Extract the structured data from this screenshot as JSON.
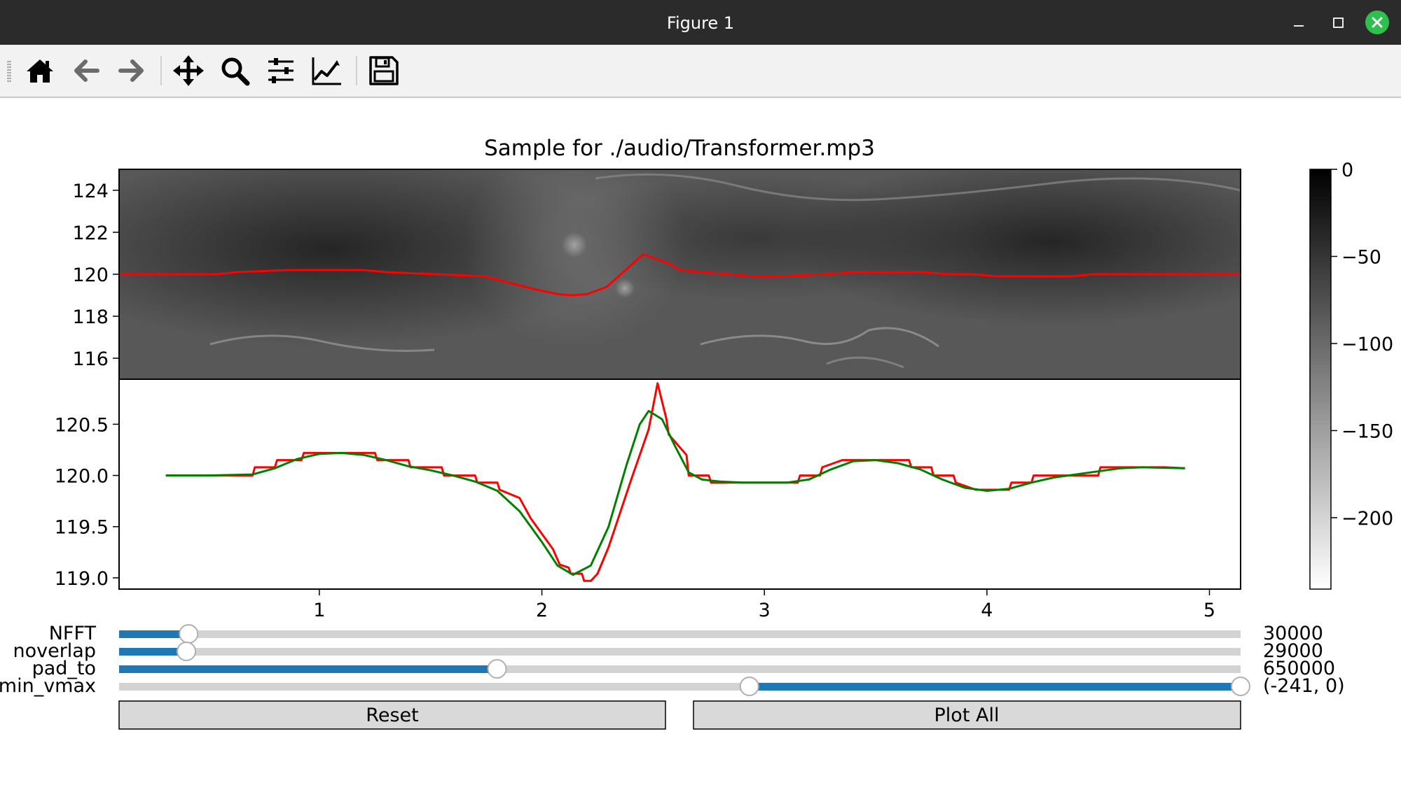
{
  "window": {
    "title": "Figure 1",
    "close_color": "#2ebf4f"
  },
  "toolbar": {
    "buttons": [
      {
        "name": "home-icon",
        "tooltip": "Reset original view"
      },
      {
        "name": "back-arrow-icon",
        "tooltip": "Back to previous view"
      },
      {
        "name": "forward-arrow-icon",
        "tooltip": "Forward to next view"
      },
      {
        "name": "pan-icon",
        "tooltip": "Pan axes"
      },
      {
        "name": "zoom-icon",
        "tooltip": "Zoom to rectangle"
      },
      {
        "name": "subplots-icon",
        "tooltip": "Configure subplots"
      },
      {
        "name": "edit-axes-icon",
        "tooltip": "Edit axis, curve and image parameters"
      },
      {
        "name": "save-icon",
        "tooltip": "Save the figure"
      }
    ]
  },
  "figure": {
    "title": "Sample for ./audio/Transformer.mp3",
    "colors": {
      "red_line": "#ff0000",
      "green_line": "#008000",
      "slider_fill": "#1f77b4",
      "slider_track": "#d3d3d3",
      "button_face": "#d9d9d9"
    },
    "colorbar": {
      "ticks": [
        {
          "v": 0,
          "label": "0"
        },
        {
          "v": -50,
          "label": "−50"
        },
        {
          "v": -100,
          "label": "−100"
        },
        {
          "v": -150,
          "label": "−150"
        },
        {
          "v": -200,
          "label": "−200"
        }
      ],
      "range": [
        -241,
        0
      ],
      "colormap": "gray_r"
    }
  },
  "chart_data": [
    {
      "type": "heatmap",
      "colormap": "gray_r",
      "xlim": [
        0.3,
        4.9
      ],
      "ylim": [
        115,
        125
      ],
      "yticks": [
        116,
        118,
        120,
        122,
        124
      ],
      "xticks": [
        1,
        2,
        3,
        4
      ],
      "xtick_labels": [
        "1",
        "2",
        "3",
        "4"
      ],
      "xtick_position": "bottom-inside",
      "series": [
        {
          "color": "#ff0000",
          "x": [
            0.3,
            0.7,
            0.78,
            1.0,
            1.1,
            1.2,
            1.3,
            1.4,
            1.6,
            1.8,
            1.9,
            2.0,
            2.1,
            2.16,
            2.22,
            2.3,
            2.45,
            2.56,
            2.6,
            2.7,
            2.8,
            2.9,
            3.0,
            3.1,
            3.2,
            3.3,
            3.4,
            3.5,
            3.6,
            3.7,
            3.8,
            3.9,
            4.0,
            4.1,
            4.2,
            4.3,
            4.5,
            4.9
          ],
          "y": [
            120.0,
            120.0,
            120.1,
            120.2,
            120.2,
            120.2,
            120.2,
            120.1,
            120.0,
            119.9,
            119.6,
            119.3,
            119.05,
            119.0,
            119.05,
            119.4,
            120.95,
            120.5,
            120.2,
            120.1,
            120.0,
            119.9,
            119.9,
            119.95,
            120.0,
            120.1,
            120.1,
            120.1,
            120.1,
            120.0,
            120.0,
            119.9,
            119.9,
            119.9,
            119.9,
            120.0,
            120.0,
            120.0
          ]
        }
      ]
    },
    {
      "type": "line",
      "xlim": [
        0.1,
        5.14
      ],
      "ylim": [
        118.89,
        120.94
      ],
      "xticks": [
        1,
        2,
        3,
        4,
        5
      ],
      "xtick_labels": [
        "1",
        "2",
        "3",
        "4",
        "5"
      ],
      "yticks": [
        119.0,
        119.5,
        120.0,
        120.5
      ],
      "ytick_labels": [
        "119.0",
        "119.5",
        "120.0",
        "120.5"
      ],
      "grid": false,
      "series": [
        {
          "color": "#ff0000",
          "x": [
            0.31,
            0.7,
            0.71,
            0.8,
            0.81,
            0.92,
            0.93,
            1.05,
            1.15,
            1.25,
            1.26,
            1.4,
            1.41,
            1.55,
            1.56,
            1.7,
            1.71,
            1.8,
            1.81,
            1.9,
            1.95,
            2.05,
            2.08,
            2.12,
            2.13,
            2.18,
            2.19,
            2.22,
            2.25,
            2.3,
            2.4,
            2.48,
            2.52,
            2.56,
            2.57,
            2.65,
            2.66,
            2.75,
            2.76,
            2.9,
            3.0,
            3.1,
            3.15,
            3.16,
            3.25,
            3.26,
            3.35,
            3.45,
            3.55,
            3.65,
            3.66,
            3.75,
            3.76,
            3.85,
            3.86,
            3.95,
            4.05,
            4.1,
            4.11,
            4.2,
            4.21,
            4.35,
            4.5,
            4.51,
            4.6,
            4.61,
            4.8,
            4.89
          ],
          "y": [
            120.0,
            120.0,
            120.08,
            120.08,
            120.15,
            120.15,
            120.22,
            120.22,
            120.22,
            120.22,
            120.15,
            120.15,
            120.08,
            120.08,
            120.0,
            120.0,
            119.93,
            119.93,
            119.86,
            119.78,
            119.58,
            119.28,
            119.13,
            119.1,
            119.04,
            119.04,
            118.97,
            118.97,
            119.04,
            119.3,
            119.95,
            120.45,
            120.9,
            120.55,
            120.4,
            120.2,
            120.0,
            120.0,
            119.93,
            119.93,
            119.93,
            119.93,
            119.93,
            120.0,
            120.0,
            120.08,
            120.15,
            120.15,
            120.15,
            120.15,
            120.08,
            120.08,
            120.0,
            120.0,
            119.93,
            119.86,
            119.86,
            119.86,
            119.93,
            119.93,
            120.0,
            120.0,
            120.0,
            120.08,
            120.08,
            120.08,
            120.08,
            120.07
          ]
        },
        {
          "color": "#008000",
          "x": [
            0.31,
            0.5,
            0.7,
            0.8,
            0.9,
            1.0,
            1.1,
            1.2,
            1.3,
            1.4,
            1.5,
            1.6,
            1.7,
            1.8,
            1.9,
            2.0,
            2.07,
            2.14,
            2.22,
            2.3,
            2.38,
            2.44,
            2.48,
            2.54,
            2.6,
            2.66,
            2.72,
            2.8,
            2.9,
            3.0,
            3.1,
            3.2,
            3.3,
            3.4,
            3.5,
            3.6,
            3.7,
            3.8,
            3.9,
            4.0,
            4.1,
            4.2,
            4.3,
            4.4,
            4.5,
            4.6,
            4.7,
            4.89
          ],
          "y": [
            120.0,
            120.0,
            120.01,
            120.07,
            120.16,
            120.21,
            120.22,
            120.2,
            120.15,
            120.09,
            120.05,
            120.0,
            119.94,
            119.85,
            119.65,
            119.35,
            119.12,
            119.03,
            119.12,
            119.5,
            120.1,
            120.5,
            120.63,
            120.55,
            120.28,
            120.03,
            119.96,
            119.94,
            119.93,
            119.93,
            119.93,
            119.96,
            120.06,
            120.14,
            120.15,
            120.12,
            120.06,
            119.96,
            119.88,
            119.85,
            119.87,
            119.93,
            119.98,
            120.01,
            120.04,
            120.07,
            120.08,
            120.07
          ]
        }
      ]
    }
  ],
  "sliders": [
    {
      "label": "NFFT",
      "value_text": "30000",
      "fill": [
        0,
        0.062
      ]
    },
    {
      "label": "noverlap",
      "value_text": "29000",
      "fill": [
        0,
        0.06
      ]
    },
    {
      "label": "pad_to",
      "value_text": "650000",
      "fill": [
        0,
        0.337
      ]
    },
    {
      "label": "min_vmax",
      "value_text": "(-241, 0)",
      "fill": [
        0.562,
        1.0
      ]
    }
  ],
  "buttons": {
    "reset": "Reset",
    "plot_all": "Plot All"
  }
}
